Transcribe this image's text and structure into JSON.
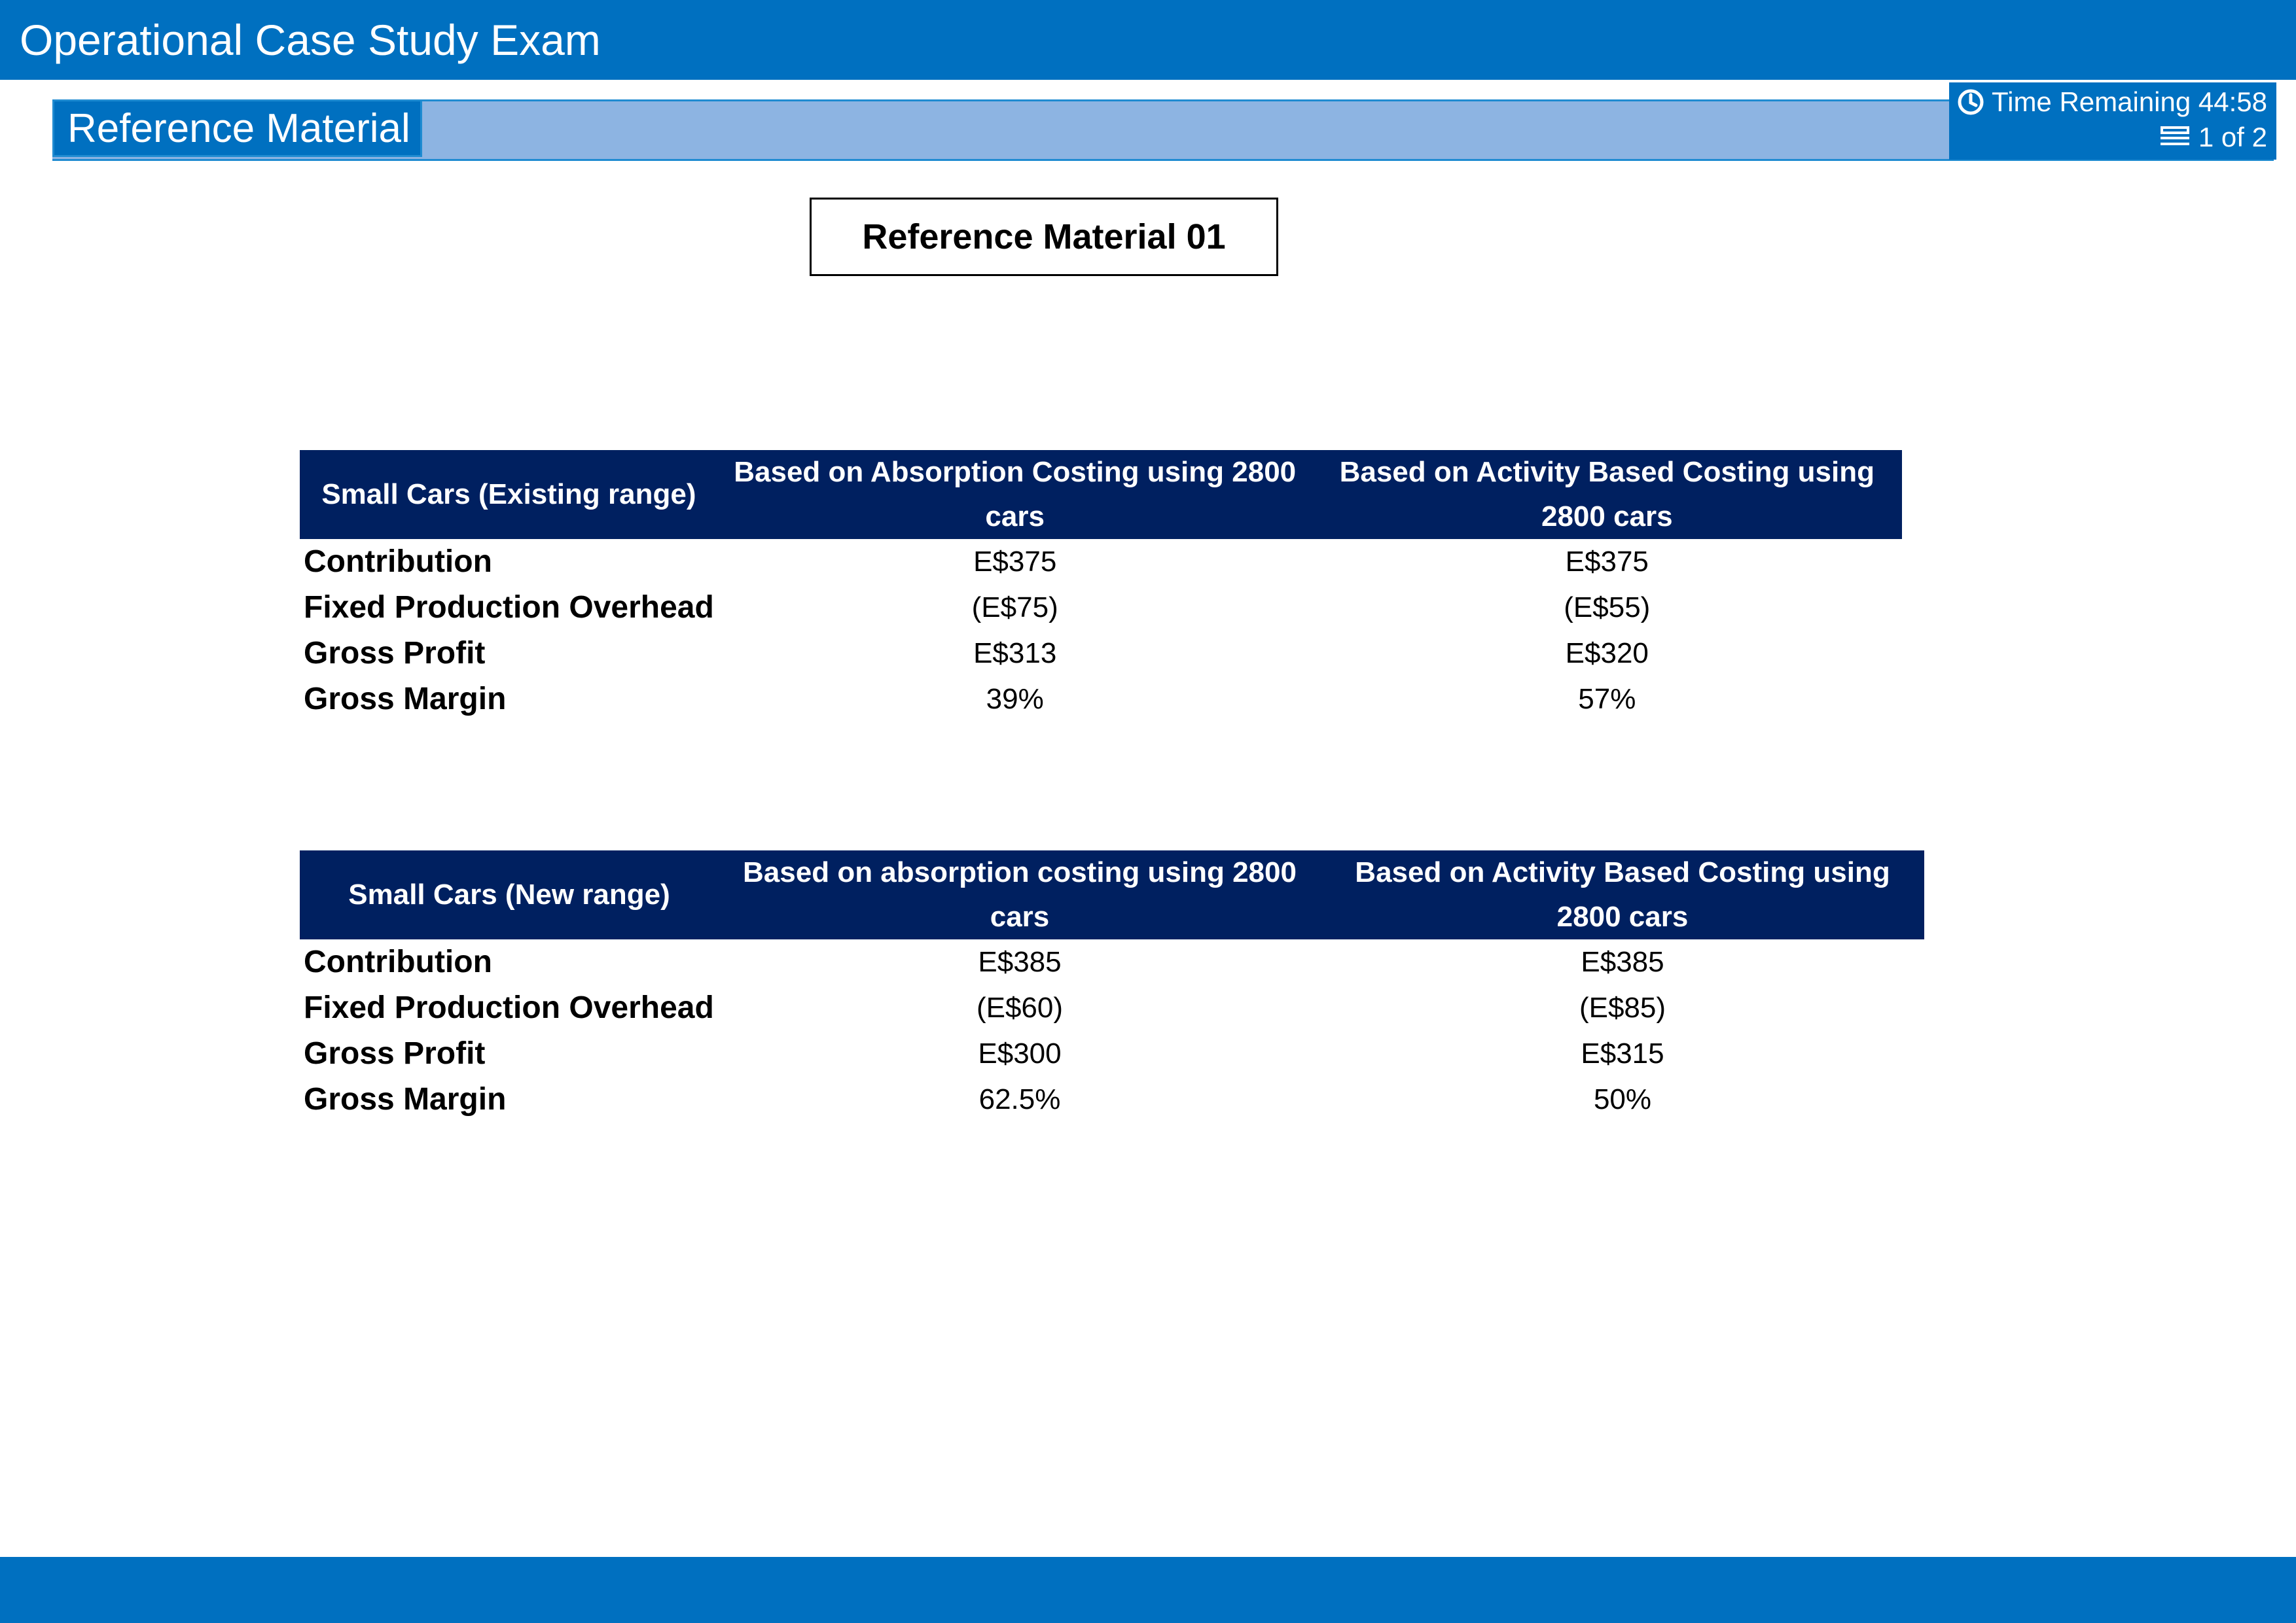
{
  "header": {
    "exam_title": "Operational Case Study Exam"
  },
  "section": {
    "label": "Reference Material"
  },
  "timer": {
    "label": "Time Remaining 44:58",
    "page": "1 of 2",
    "icons": [
      "clock-icon",
      "page-stack-icon"
    ]
  },
  "reference_title": "Reference Material 01",
  "tables": [
    {
      "headers": [
        "Small Cars (Existing range)",
        "Based on Absorption Costing using 2800 cars",
        "Based on Activity Based Costing using 2800 cars"
      ],
      "rows": [
        [
          "Contribution",
          "E$375",
          "E$375"
        ],
        [
          "Fixed Production Overhead",
          "(E$75)",
          "(E$55)"
        ],
        [
          "Gross Profit",
          "E$313",
          "E$320"
        ],
        [
          "Gross Margin",
          "39%",
          "57%"
        ]
      ]
    },
    {
      "headers": [
        "Small Cars (New range)",
        "Based on absorption costing using 2800 cars",
        "Based on Activity Based Costing using 2800 cars"
      ],
      "rows": [
        [
          "Contribution",
          "E$385",
          "E$385"
        ],
        [
          "Fixed Production Overhead",
          "(E$60)",
          "(E$85)"
        ],
        [
          "Gross Profit",
          "E$300",
          "E$315"
        ],
        [
          "Gross Margin",
          "62.5%",
          "50%"
        ]
      ]
    }
  ],
  "colors": {
    "brand_blue": "#0070c0",
    "band_light_blue": "#8db4e2",
    "table_header_navy": "#002060"
  }
}
